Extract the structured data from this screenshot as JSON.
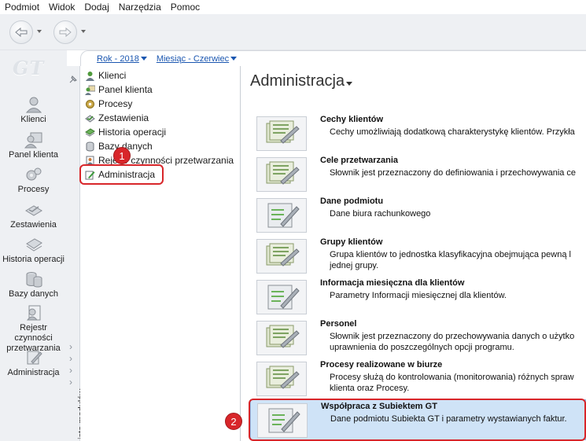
{
  "menubar": [
    "Podmiot",
    "Widok",
    "Dodaj",
    "Narzędzia",
    "Pomoc"
  ],
  "logo": "GT",
  "filters": {
    "year": "Rok - 2018",
    "month": "Miesiąc - Czerwiec"
  },
  "left_nav": [
    "Klienci",
    "Panel klienta",
    "Procesy",
    "Zestawienia",
    "Historia operacji",
    "Bazy danych",
    "Rejestr czynności przetwarzania",
    "Administracja"
  ],
  "module_strip_label": "Lista modułów",
  "tree": [
    "Klienci",
    "Panel klienta",
    "Procesy",
    "Zestawienia",
    "Historia operacji",
    "Bazy danych",
    "Rejestr czynności przetwarzania",
    "Administracja"
  ],
  "page_title": "Administracja",
  "items": [
    {
      "title": "Cechy klientów",
      "desc": "Cechy umożliwiają dodatkową charakterystykę klientów. Przykła"
    },
    {
      "title": "Cele przetwarzania",
      "desc": "Słownik jest przeznaczony do definiowania i przechowywania ce"
    },
    {
      "title": "Dane podmiotu",
      "desc": "Dane biura rachunkowego"
    },
    {
      "title": "Grupy klientów",
      "desc": "Grupa klientów to jednostka klasyfikacyjna obejmująca pewną l",
      "desc2": "jednej grupy."
    },
    {
      "title": "Informacja miesięczna dla klientów",
      "desc": "Parametry Informacji miesięcznej dla klientów."
    },
    {
      "title": "Personel",
      "desc": "Słownik jest przeznaczony do przechowywania danych o użytko",
      "desc2": "uprawnienia do poszczególnych opcji programu."
    },
    {
      "title": "Procesy realizowane w biurze",
      "desc": "Procesy służą do kontrolowania (monitorowania) różnych spraw",
      "desc2": "klienta oraz Procesy."
    },
    {
      "title": "Współpraca z Subiektem GT",
      "desc": "Dane podmiotu Subiekta GT i parametry wystawianych faktur."
    }
  ],
  "callouts": [
    "1",
    "2"
  ]
}
